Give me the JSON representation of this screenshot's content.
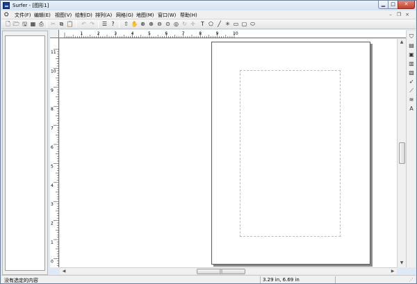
{
  "window": {
    "title": "Surfer - [图形1]"
  },
  "menu": {
    "items": [
      "文件(F)",
      "编辑(E)",
      "视图(V)",
      "绘制(D)",
      "排列(A)",
      "网格(G)",
      "地图(M)",
      "窗口(W)",
      "帮助(H)"
    ]
  },
  "ruler": {
    "top_ticks": [
      "1",
      "2",
      "3",
      "4",
      "5",
      "6",
      "7",
      "8",
      "9",
      "10"
    ],
    "left_ticks": [
      "11",
      "10",
      "9",
      "8",
      "7",
      "6",
      "5",
      "4",
      "3",
      "2",
      "1",
      "0"
    ]
  },
  "hscroll": {
    "thumb_grip": "|||"
  },
  "status": {
    "message": "没有选定的内容",
    "coordinates": "3.29 in, 6.69 in"
  },
  "colors": {
    "title_bar": "#d3e1f1",
    "close_button": "#c2402c",
    "app_icon": "#1f3a8a",
    "page_border": "#5a5a5a"
  }
}
